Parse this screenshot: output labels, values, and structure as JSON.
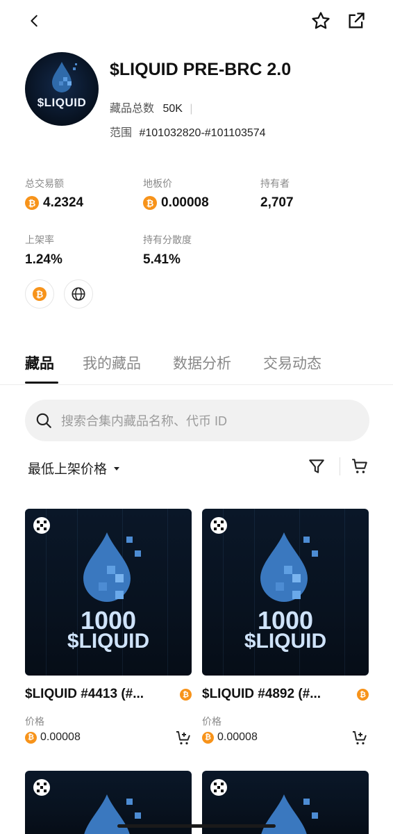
{
  "header": {
    "back": "back-icon",
    "star": "star-icon",
    "share": "share-icon"
  },
  "collection": {
    "avatar_text": "$LIQUID",
    "title": "$LIQUID PRE-BRC 2.0",
    "total_label": "藏品总数",
    "total_value": "50K",
    "range_label": "范围",
    "range_value": "#101032820-#101103574"
  },
  "stats": {
    "volume_label": "总交易额",
    "volume_value": "4.2324",
    "floor_label": "地板价",
    "floor_value": "0.00008",
    "holders_label": "持有者",
    "holders_value": "2,707",
    "listed_label": "上架率",
    "listed_value": "1.24%",
    "dispersion_label": "持有分散度",
    "dispersion_value": "5.41%"
  },
  "tabs": [
    "藏品",
    "我的藏品",
    "数据分析",
    "交易动态"
  ],
  "search": {
    "placeholder": "搜索合集内藏品名称、代币 ID"
  },
  "sort": {
    "label": "最低上架价格"
  },
  "cards": [
    {
      "amount": "1000",
      "token": "$LIQUID",
      "name": "$LIQUID #4413 (#...",
      "price_label": "价格",
      "price": "0.00008"
    },
    {
      "amount": "1000",
      "token": "$LIQUID",
      "name": "$LIQUID #4892 (#...",
      "price_label": "价格",
      "price": "0.00008"
    }
  ],
  "colors": {
    "btc": "#f7931a",
    "accent": "#111111"
  }
}
